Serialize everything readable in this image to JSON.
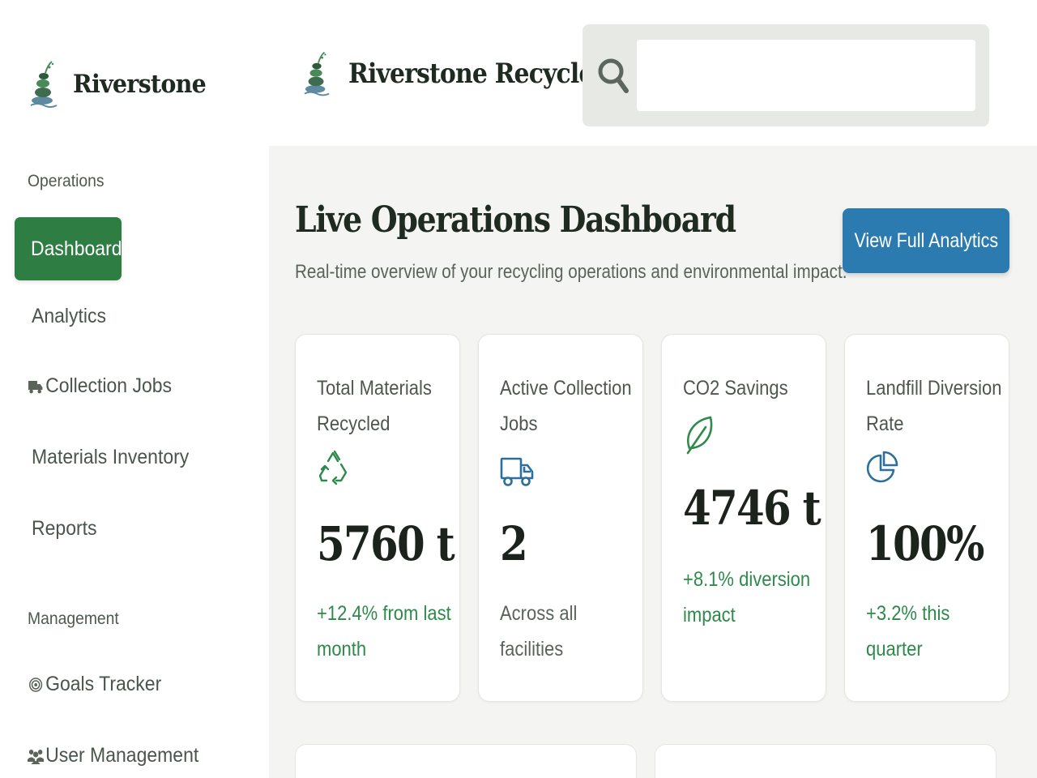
{
  "sidebar": {
    "brand_name": "Riverstone",
    "sections": {
      "operations": "Operations",
      "management": "Management"
    },
    "items": [
      {
        "label": "Dashboard",
        "icon": ""
      },
      {
        "label": "Analytics",
        "icon": ""
      },
      {
        "label": "Collection Jobs",
        "icon": "truck-icon"
      },
      {
        "label": "Materials Inventory",
        "icon": ""
      },
      {
        "label": "Reports",
        "icon": ""
      },
      {
        "label": "Goals Tracker",
        "icon": "target-icon"
      },
      {
        "label": "User Management",
        "icon": "users-icon"
      }
    ]
  },
  "header": {
    "app_title": "Riverstone Recycler",
    "search": {
      "value": "",
      "placeholder": "",
      "icon": "search-icon"
    }
  },
  "main": {
    "title": "Live Operations Dashboard",
    "subtitle": "Real-time overview of your recycling operations and environmental impact.",
    "analytics_button": "View Full Analytics",
    "cards": [
      {
        "label": "Total Materials Recycled",
        "icon": "recycle-icon",
        "value": "5760 t",
        "note": "+12.4% from last month",
        "note_color": "#2e8a4a"
      },
      {
        "label": "Active Collection Jobs",
        "icon": "truck-icon",
        "value": "2",
        "note": "Across all facilities",
        "note_color": "#5b645b"
      },
      {
        "label": "CO2 Savings",
        "icon": "leaf-icon",
        "value": "4746 t",
        "note": "+8.1% diversion impact",
        "note_color": "#2e8a4a"
      },
      {
        "label": "Landfill Diversion Rate",
        "icon": "pie-chart-icon",
        "value": "100%",
        "note": "+3.2% this quarter",
        "note_color": "#2e8a4a"
      }
    ]
  },
  "colors": {
    "primary_green": "#2e7d43",
    "accent_blue": "#2b7bb0",
    "positive_text": "#2e8a4a"
  }
}
